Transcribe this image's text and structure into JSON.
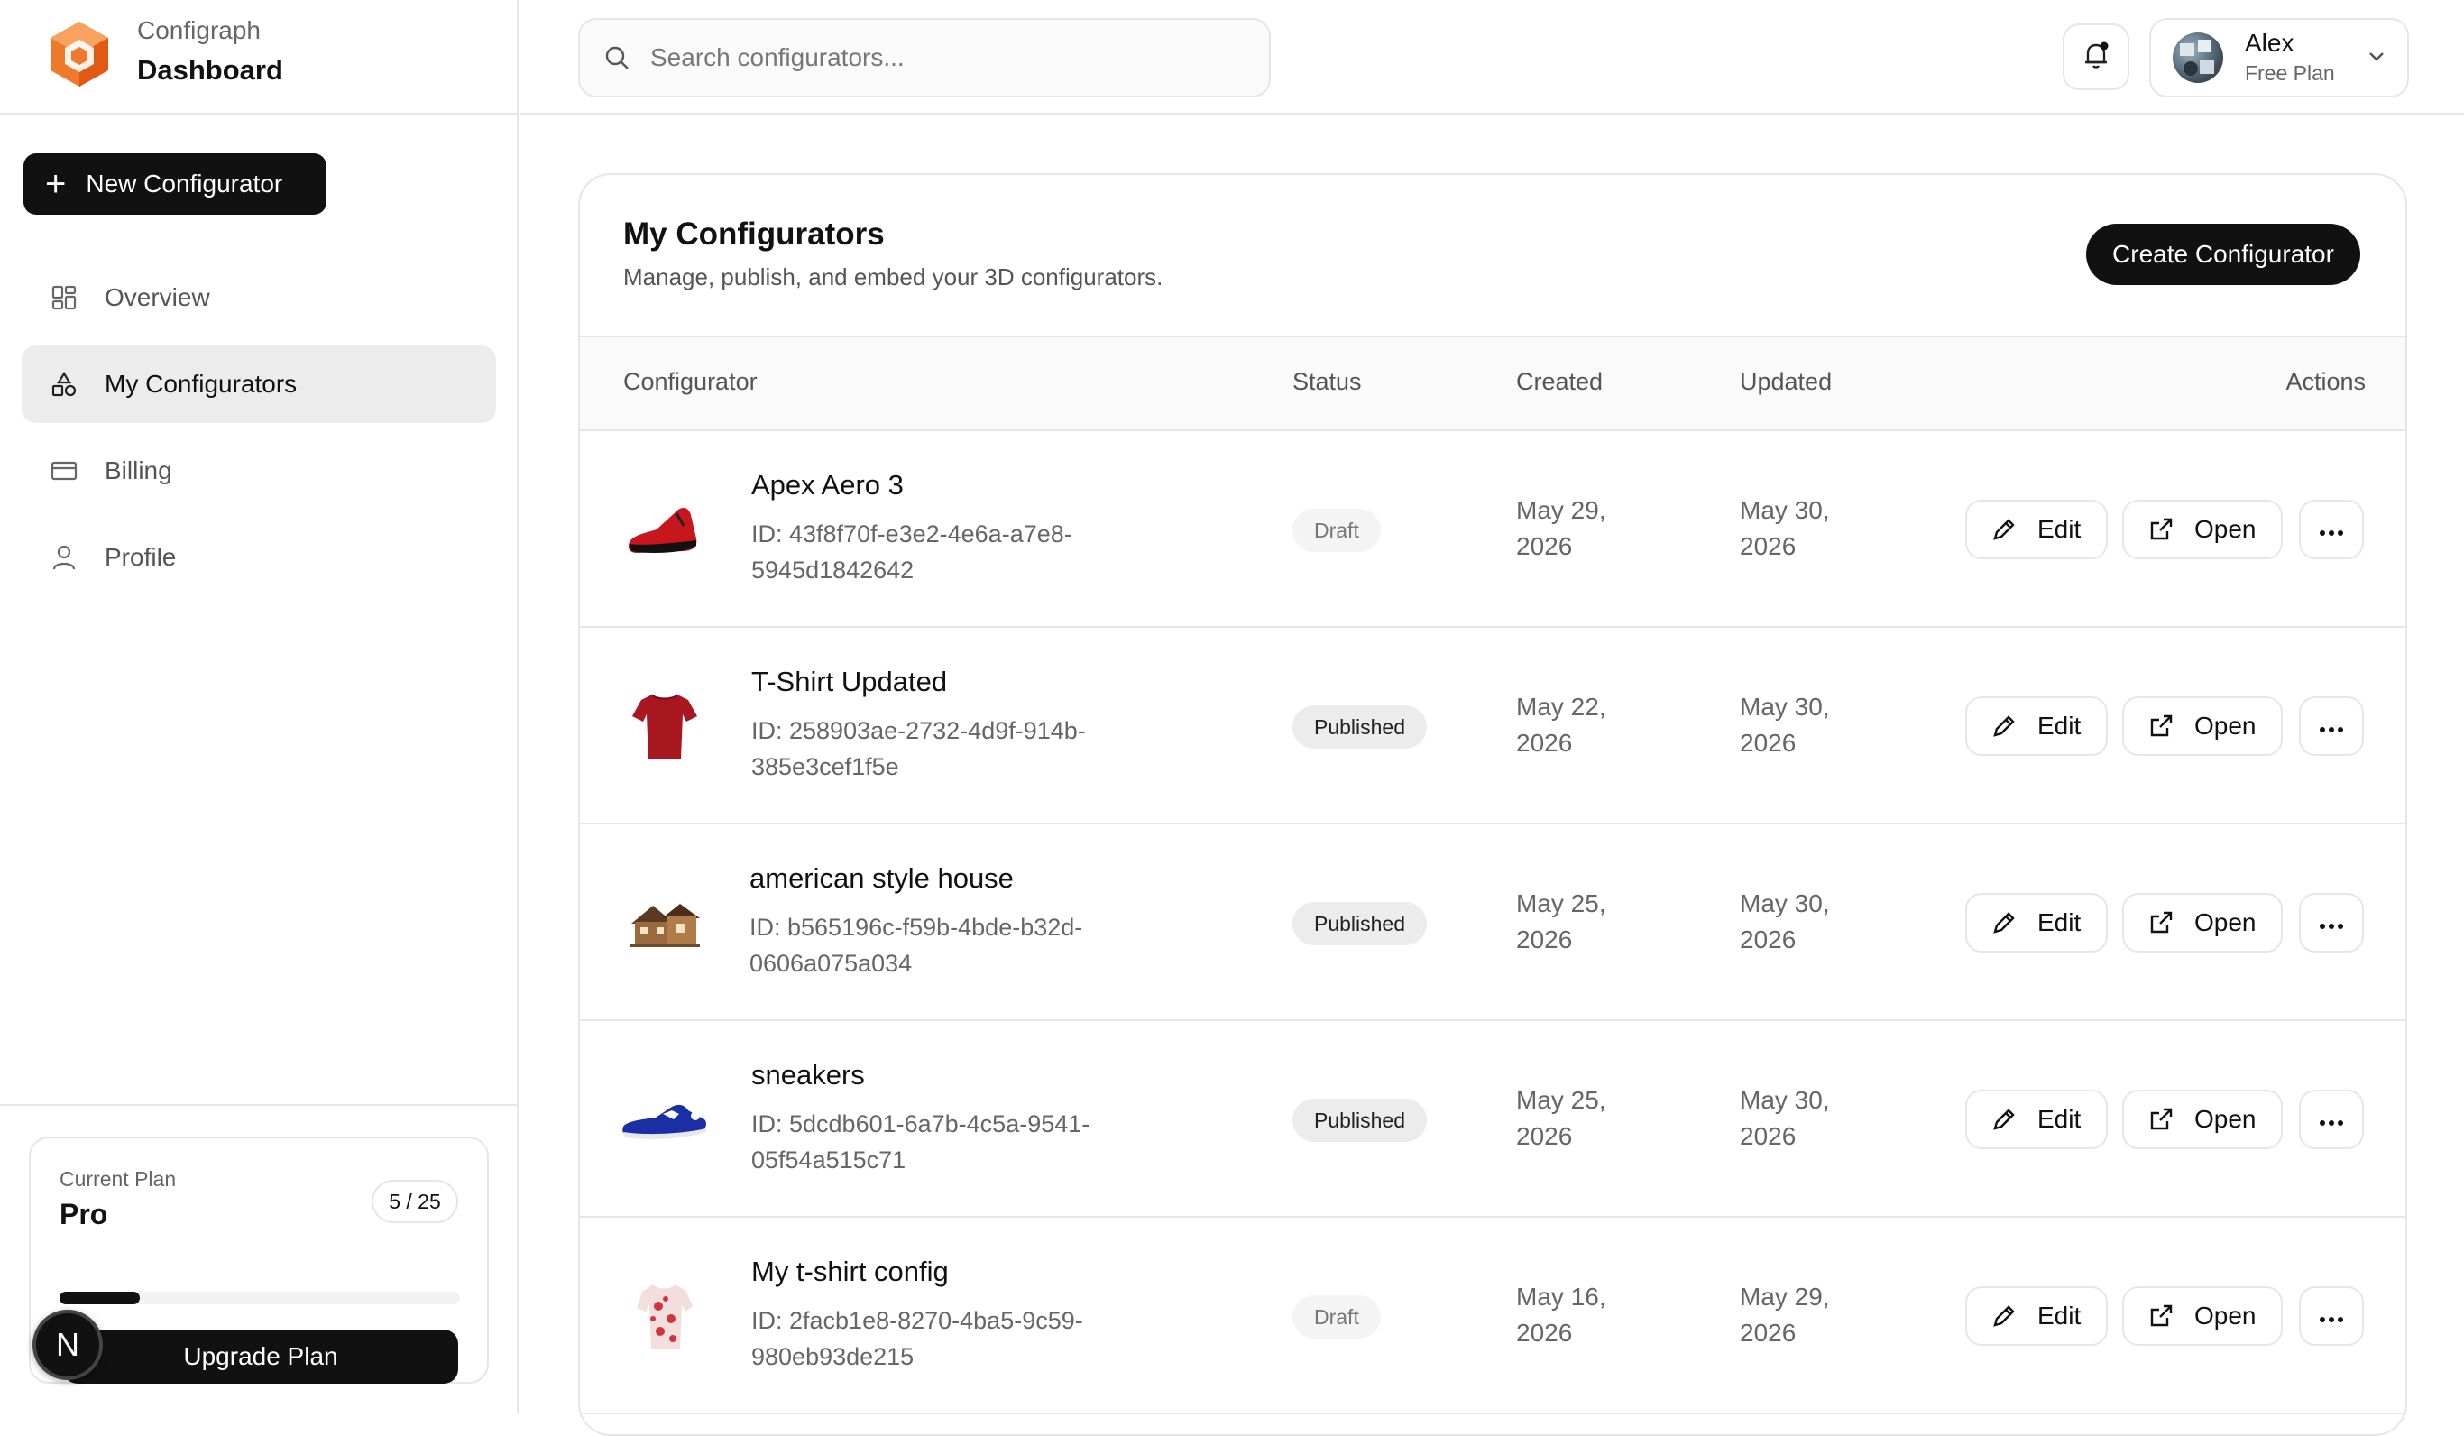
{
  "brand": {
    "app_name": "Configraph",
    "page": "Dashboard"
  },
  "sidebar": {
    "new_button": "New Configurator",
    "items": [
      {
        "label": "Overview",
        "icon": "grid-icon",
        "active": false
      },
      {
        "label": "My Configurators",
        "icon": "shapes-icon",
        "active": true
      },
      {
        "label": "Billing",
        "icon": "credit-card-icon",
        "active": false
      },
      {
        "label": "Profile",
        "icon": "user-icon",
        "active": false
      }
    ],
    "plan": {
      "label": "Current Plan",
      "name": "Pro",
      "count": "5 / 25",
      "usage_fraction": 0.2,
      "upgrade_button": "Upgrade Plan"
    },
    "badge_letter": "N"
  },
  "header": {
    "search_placeholder": "Search configurators...",
    "user": {
      "name": "Alex",
      "plan": "Free Plan"
    }
  },
  "main": {
    "title": "My Configurators",
    "subtitle": "Manage, publish, and embed your 3D configurators.",
    "create_button": "Create Configurator",
    "columns": {
      "configurator": "Configurator",
      "status": "Status",
      "created": "Created",
      "updated": "Updated",
      "actions": "Actions"
    },
    "actions": {
      "edit": "Edit",
      "open": "Open"
    },
    "rows": [
      {
        "name": "Apex Aero 3",
        "id_line1": "ID: 43f8f70f-e3e2-4e6a-a7e8-",
        "id_line2": "5945d1842642",
        "status": "Draft",
        "created_1": "May 29,",
        "created_2": "2026",
        "updated_1": "May 30,",
        "updated_2": "2026",
        "thumb": "red-sneaker"
      },
      {
        "name": "T-Shirt Updated",
        "id_line1": "ID: 258903ae-2732-4d9f-914b-",
        "id_line2": "385e3cef1f5e",
        "status": "Published",
        "created_1": "May 22,",
        "created_2": "2026",
        "updated_1": "May 30,",
        "updated_2": "2026",
        "thumb": "red-tshirt"
      },
      {
        "name": "american style house",
        "id_line1": "ID: b565196c-f59b-4bde-b32d-",
        "id_line2": "0606a075a034",
        "status": "Published",
        "created_1": "May 25,",
        "created_2": "2026",
        "updated_1": "May 30,",
        "updated_2": "2026",
        "thumb": "wooden-house"
      },
      {
        "name": "sneakers",
        "id_line1": "ID: 5dcdb601-6a7b-4c5a-9541-",
        "id_line2": "05f54a515c71",
        "status": "Published",
        "created_1": "May 25,",
        "created_2": "2026",
        "updated_1": "May 30,",
        "updated_2": "2026",
        "thumb": "blue-sneaker"
      },
      {
        "name": "My t-shirt config",
        "id_line1": "ID: 2facb1e8-8270-4ba5-9c59-",
        "id_line2": "980eb93de215",
        "status": "Draft",
        "created_1": "May 16,",
        "created_2": "2026",
        "updated_1": "May 29,",
        "updated_2": "2026",
        "thumb": "floral-tshirt"
      }
    ]
  },
  "colors": {
    "primary": "#111111",
    "border": "#e6e6e6",
    "muted_text": "#666666",
    "active_nav": "#ececec",
    "logo_orange": "#f07a2b"
  }
}
